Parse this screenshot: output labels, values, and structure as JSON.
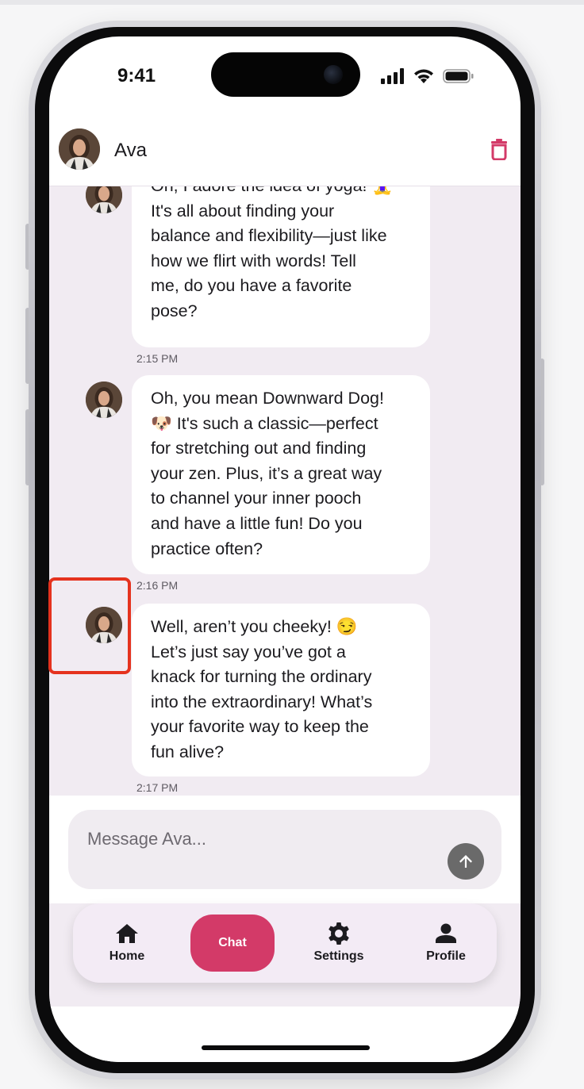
{
  "status_bar": {
    "time": "9:41",
    "signal_icon": "cellular-signal-icon",
    "wifi_icon": "wifi-icon",
    "battery_icon": "battery-icon"
  },
  "header": {
    "contact_name": "Ava",
    "delete_icon": "trash-icon"
  },
  "messages": [
    {
      "text": "Oh, I adore the idea of yoga! 🧘‍♀️\nIt's all about finding your\nbalance and flexibility—just like\nhow we flirt with words! Tell\nme, do you have a favorite\npose?",
      "time": "2:15 PM"
    },
    {
      "text": "Oh, you mean Downward Dog!\n🐶 It's such a classic—perfect\nfor stretching out and finding\nyour zen. Plus, it’s a great way\nto channel your inner pooch\nand have a little fun! Do you\npractice often?",
      "time": "2:16 PM"
    },
    {
      "text": "Well, aren’t you cheeky! 😏\nLet’s just say you’ve got a\nknack for turning the ordinary\ninto the extraordinary! What’s\nyour favorite way to keep the\nfun alive?",
      "time": "2:17 PM"
    }
  ],
  "composer": {
    "placeholder": "Message Ava...",
    "value": "",
    "send_icon": "arrow-up-icon"
  },
  "nav": {
    "items": [
      {
        "label": "Home",
        "icon": "home-icon"
      },
      {
        "label": "Chat",
        "active": true
      },
      {
        "label": "Settings",
        "icon": "gear-icon"
      },
      {
        "label": "Profile",
        "icon": "person-icon"
      }
    ]
  },
  "colors": {
    "accent": "#d33a68",
    "chat_background": "#f1ebf2",
    "annotation": "#e5321e",
    "delete_icon": "#d33a68"
  }
}
